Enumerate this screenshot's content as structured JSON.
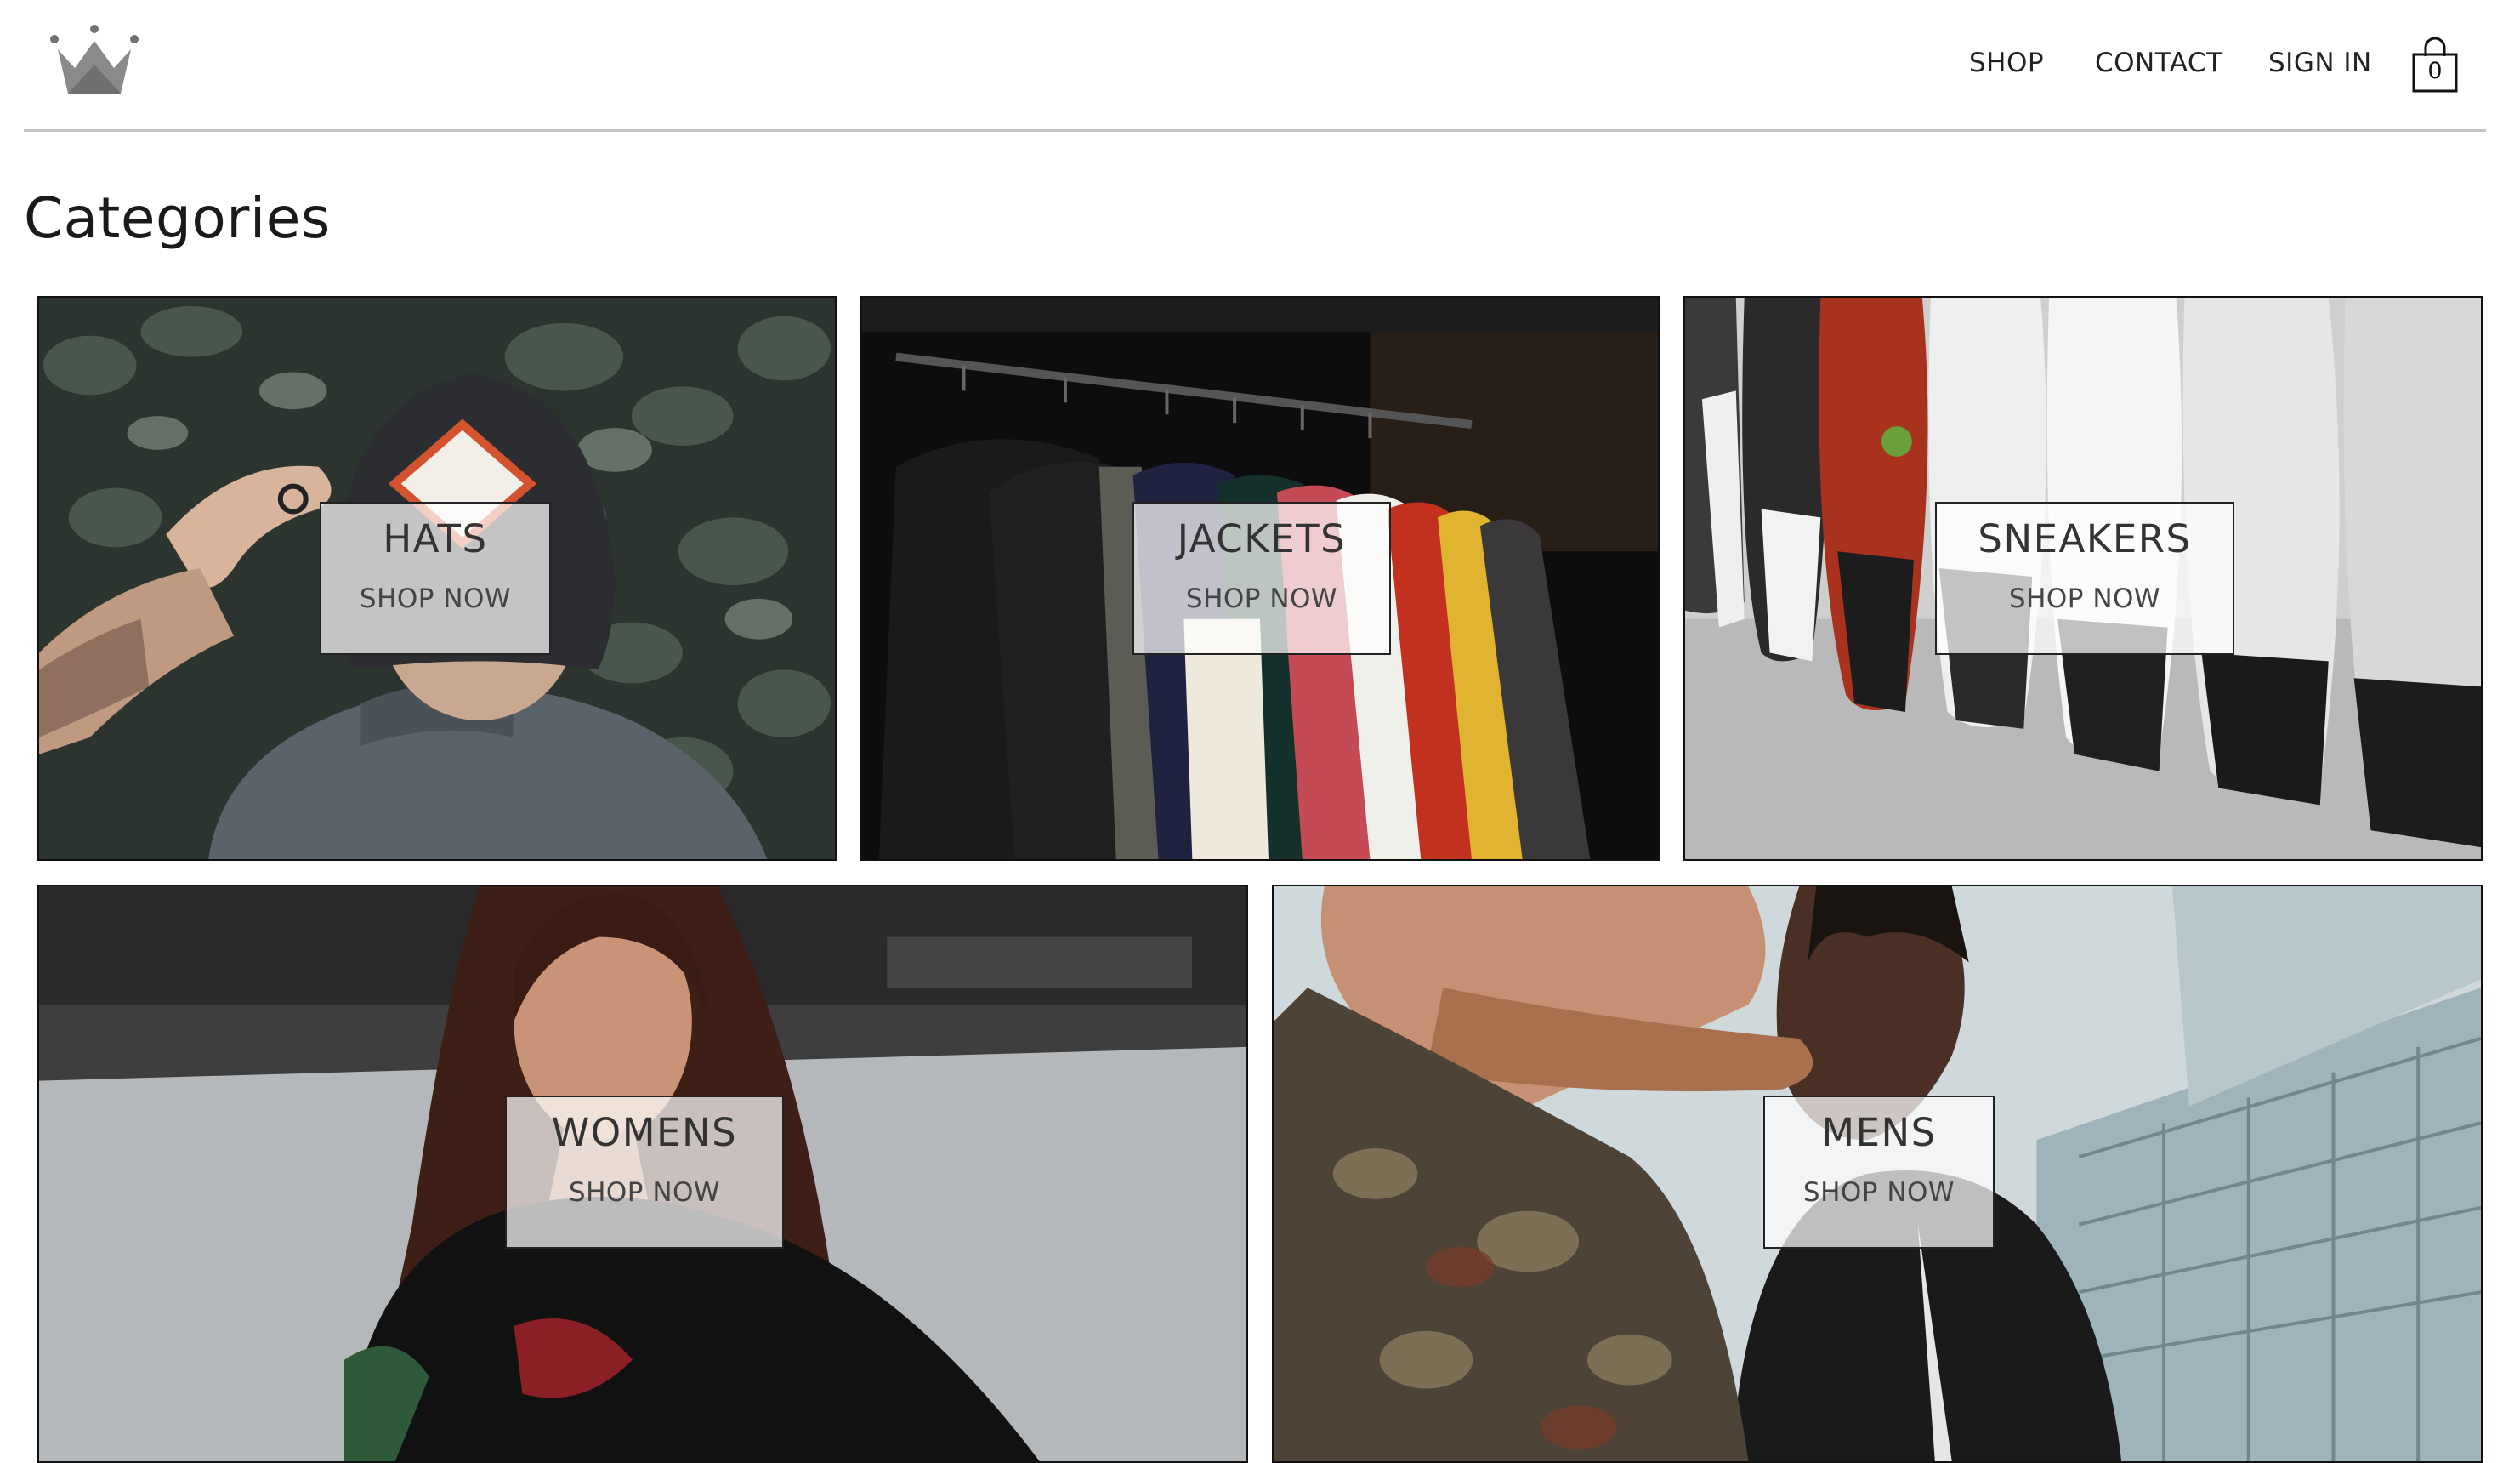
{
  "header": {
    "logo_icon": "crown-icon",
    "nav": [
      {
        "label": "SHOP"
      },
      {
        "label": "CONTACT"
      },
      {
        "label": "SIGN IN"
      }
    ],
    "cart": {
      "icon": "shopping-bag-icon",
      "count": "0"
    }
  },
  "page": {
    "title": "Categories"
  },
  "categories": [
    {
      "title": "HATS",
      "cta": "SHOP NOW"
    },
    {
      "title": "JACKETS",
      "cta": "SHOP NOW"
    },
    {
      "title": "SNEAKERS",
      "cta": "SHOP NOW"
    },
    {
      "title": "WOMENS",
      "cta": "SHOP NOW"
    },
    {
      "title": "MENS",
      "cta": "SHOP NOW"
    }
  ],
  "colors": {
    "border": "#111111",
    "divider": "#c4c4c4",
    "label_bg": "#ffffffb8",
    "logo": "#808080"
  }
}
